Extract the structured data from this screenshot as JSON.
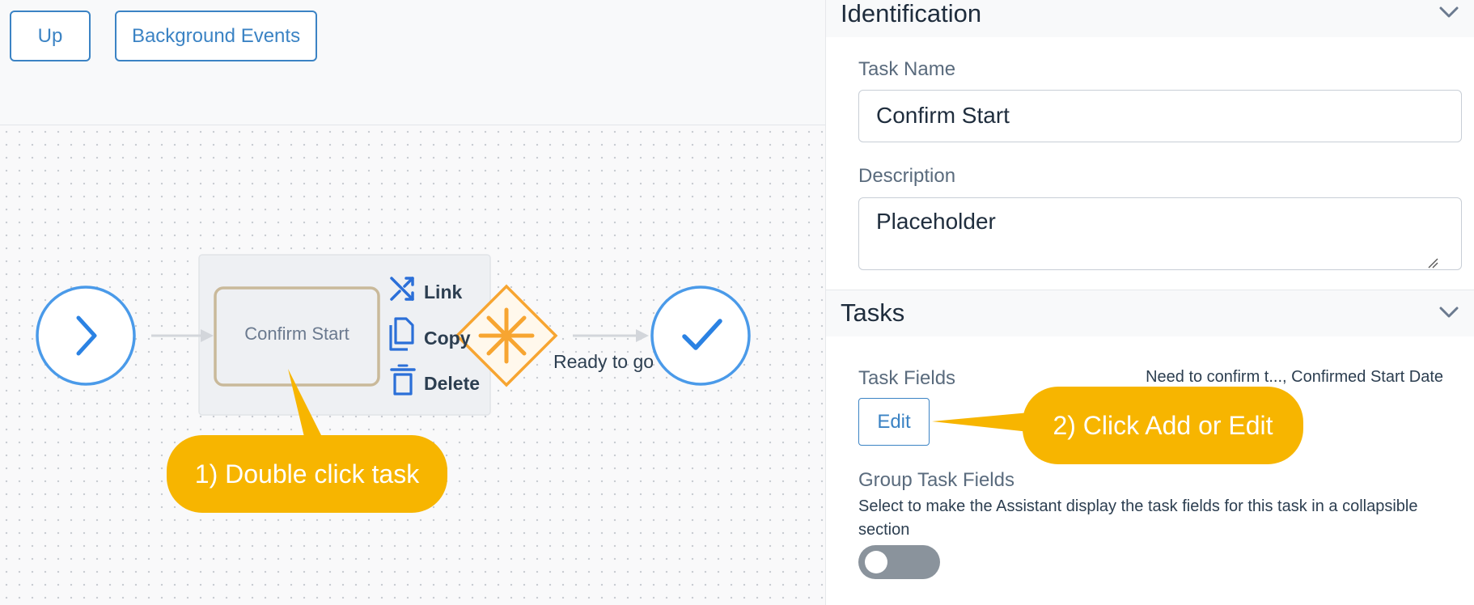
{
  "toolbar": {
    "up_label": "Up",
    "background_events_label": "Background Events"
  },
  "diagram": {
    "task_label": "Confirm Start",
    "context_menu": {
      "link": "Link",
      "copy": "Copy",
      "delete": "Delete"
    },
    "flow_label": "Ready to go",
    "start_icon": "chevron-right-icon",
    "end_icon": "checkmark-icon",
    "gateway_icon": "asterisk-icon"
  },
  "callouts": {
    "step1": "1) Double click task",
    "step2": "2) Click Add or Edit"
  },
  "panel": {
    "identification": {
      "title": "Identification",
      "task_name_label": "Task Name",
      "task_name_value": "Confirm Start",
      "description_label": "Description",
      "description_value": "Placeholder"
    },
    "tasks": {
      "title": "Tasks",
      "task_fields_label": "Task Fields",
      "task_fields_value": "Need to confirm t..., Confirmed Start Date",
      "edit_label": "Edit",
      "group_label": "Group Task Fields",
      "group_description": "Select to make the Assistant display the task fields for this task in a collapsible section",
      "group_toggle_on": false
    }
  },
  "colors": {
    "accent_blue": "#3b83c4",
    "node_blue": "#4a9ae9",
    "gateway_orange": "#f7a531",
    "callout_yellow": "#f7b500",
    "task_border": "#c9b99a"
  }
}
